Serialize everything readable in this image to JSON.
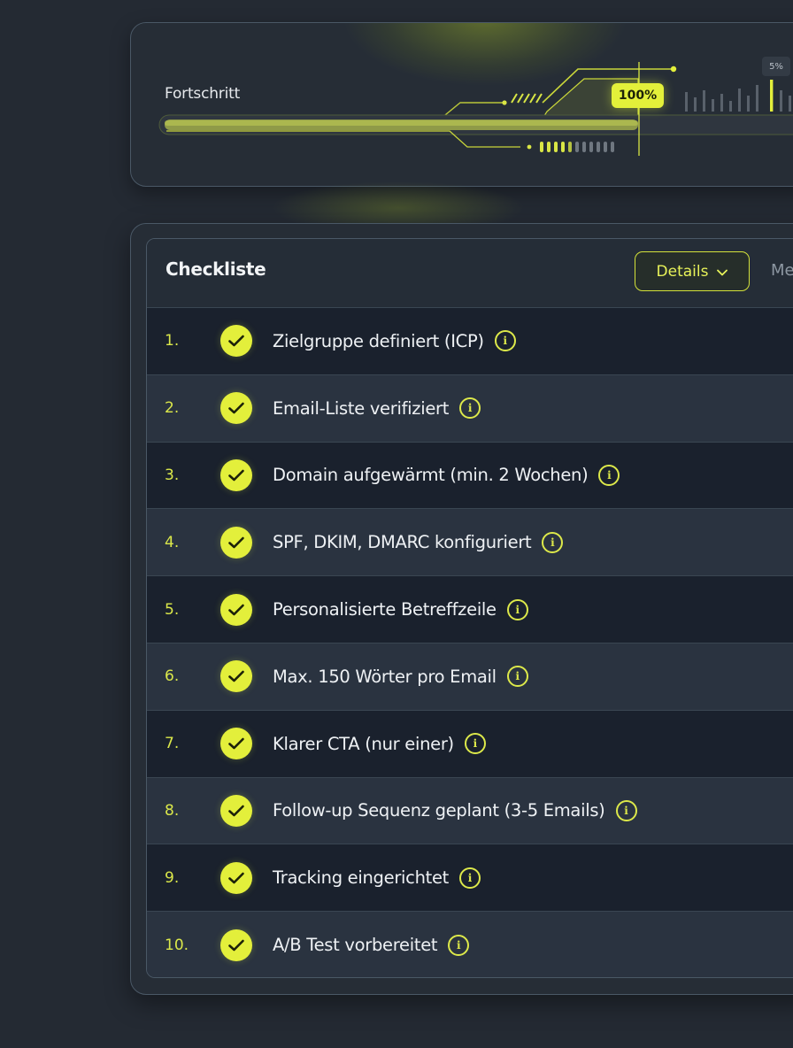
{
  "progress": {
    "label": "Fortschritt",
    "percent_text": "100%",
    "percent_value": 100,
    "scale_chip": "5%"
  },
  "checklist": {
    "title": "Checkliste",
    "details_label": "Details",
    "more_label": "Me",
    "items": [
      {
        "num": "1.",
        "text": "Zielgruppe definiert (ICP)",
        "checked": true
      },
      {
        "num": "2.",
        "text": "Email-Liste verifiziert",
        "checked": true
      },
      {
        "num": "3.",
        "text": "Domain aufgewärmt (min. 2 Wochen)",
        "checked": true
      },
      {
        "num": "4.",
        "text": "SPF, DKIM, DMARC konfiguriert",
        "checked": true
      },
      {
        "num": "5.",
        "text": "Personalisierte Betreffzeile",
        "checked": true
      },
      {
        "num": "6.",
        "text": "Max. 150 Wörter pro Email",
        "checked": true
      },
      {
        "num": "7.",
        "text": "Klarer CTA (nur einer)",
        "checked": true
      },
      {
        "num": "8.",
        "text": "Follow-up Sequenz geplant (3-5 Emails)",
        "checked": true
      },
      {
        "num": "9.",
        "text": "Tracking eingerichtet",
        "checked": true
      },
      {
        "num": "10.",
        "text": "A/B Test vorbereitet",
        "checked": true
      }
    ]
  },
  "colors": {
    "accent": "#e3ef3b",
    "background": "#242a33",
    "card": "#262d36",
    "row_dark": "#1a212d",
    "row_light": "#2a3340"
  },
  "icons": [
    "check-icon",
    "info-icon",
    "chevron-down-icon"
  ]
}
